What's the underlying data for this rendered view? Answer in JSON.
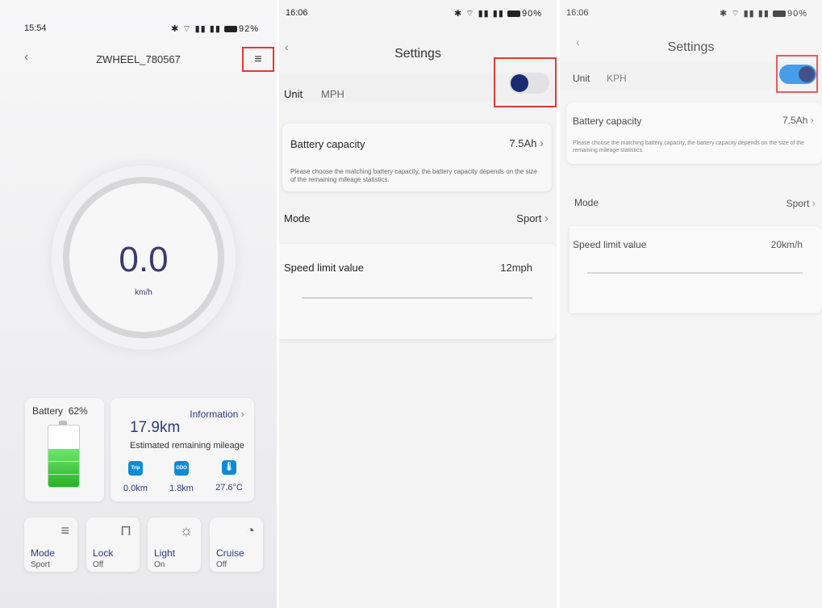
{
  "home": {
    "time": "15:54",
    "status_icons": "✱ ⌔ ▮▮ ▮▮",
    "battery_pct": "92%",
    "device_name": "ZWHEEL_780567",
    "speed": "0.0",
    "speed_unit": "km/h",
    "battery_card": {
      "label": "Battery",
      "percent": "62%",
      "level": 0.62
    },
    "info": {
      "link": "Information",
      "distance": "17.9km",
      "subtitle": "Estimated remaining mileage",
      "stats": [
        {
          "icon": "trip-icon",
          "icon_text": "Trip",
          "value": "0.0km"
        },
        {
          "icon": "odo-icon",
          "icon_text": "ODO",
          "value": "1.8km"
        },
        {
          "icon": "thermometer-icon",
          "icon_text": "",
          "value": "27.6°C"
        }
      ]
    },
    "tiles": [
      {
        "label": "Mode",
        "value": "Sport"
      },
      {
        "label": "Lock",
        "value": "Off"
      },
      {
        "label": "Light",
        "value": "On"
      },
      {
        "label": "Cruise",
        "value": "Off"
      }
    ]
  },
  "settings_mph": {
    "time": "16:06",
    "status_icons": "✱ ⌔ ▮▮ ▮▮",
    "battery_pct": "90%",
    "title": "Settings",
    "unit_label": "Unit",
    "unit_value": "MPH",
    "battery_capacity_label": "Battery capacity",
    "battery_capacity_value": "7.5Ah",
    "battery_desc": "Please choose the matching battery capacity, the battery capacity depends on the size of the remaining mileage statistics.",
    "mode_label": "Mode",
    "mode_value": "Sport",
    "speed_limit_label": "Speed limit value",
    "speed_limit_value": "12mph"
  },
  "settings_kph": {
    "time": "16:06",
    "status_icons": "✱ ⌔ ▮▮ ▮▮",
    "battery_pct": "90%",
    "title": "Settings",
    "unit_label": "Unit",
    "unit_value": "KPH",
    "battery_capacity_label": "Battery capacity",
    "battery_capacity_value": "7.5Ah",
    "battery_desc": "Please choose the matching battery capacity, the battery capacity depends on the size of the remaining mileage statistics.",
    "mode_label": "Mode",
    "mode_value": "Sport",
    "speed_limit_label": "Speed limit value",
    "speed_limit_value": "20km/h"
  },
  "colors": {
    "accent": "#2b3b7e",
    "toggle_on": "#1e88e5",
    "highlight": "#e53935",
    "battery_green": "#2ebd2e"
  }
}
